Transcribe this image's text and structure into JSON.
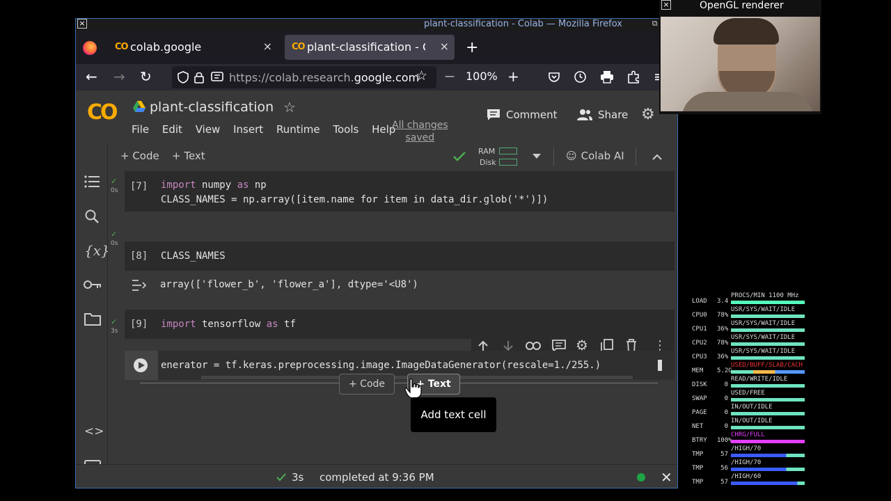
{
  "window": {
    "title": "plant-classification - Colab — Mozilla Firefox",
    "close_glyph": "×",
    "controls": "⧉ ⧈ ▣"
  },
  "browser": {
    "tabs": [
      {
        "icon": "CO",
        "label": "colab.google",
        "close": "×"
      },
      {
        "icon": "CO",
        "label": "plant-classification - Colab",
        "close": "×"
      }
    ],
    "new_tab": "+",
    "back": "←",
    "forward": "→",
    "reload": "↻",
    "url_prefix": "https://colab.research.",
    "url_domain": "google.com",
    "zoom_minus": "—",
    "zoom": "100%",
    "zoom_plus": "+"
  },
  "colab": {
    "logo": "CO",
    "notebook_title": "plant-classification",
    "menu": [
      "File",
      "Edit",
      "View",
      "Insert",
      "Runtime",
      "Tools",
      "Help"
    ],
    "save_status_line1": "All changes",
    "save_status_line2": "saved",
    "comment_label": "Comment",
    "share_label": "Share",
    "toolbar": {
      "add_code": "+ Code",
      "add_text": "+ Text",
      "ram": "RAM",
      "disk": "Disk",
      "colab_ai": "Colab AI"
    }
  },
  "cells": [
    {
      "number": "[7]",
      "duration": "0s",
      "line1_kw1": "import",
      "line1_mid": " numpy ",
      "line1_kw2": "as",
      "line1_end": " np",
      "line2": "CLASS_NAMES = np.array([item.name for item in data_dir.glob('*')])"
    },
    {
      "number": "[8]",
      "duration": "0s",
      "code": "CLASS_NAMES",
      "output": "array(['flower_b', 'flower_a'], dtype='<U8')"
    },
    {
      "number": "[9]",
      "duration": "3s",
      "line1_kw1": "import",
      "line1_mid": " tensorflow ",
      "line1_kw2": "as",
      "line1_end": " tf"
    },
    {
      "code": "enerator = tf.keras.preprocessing.image.ImageDataGenerator(rescale=1./255.)"
    }
  ],
  "insert_bar": {
    "add_code": "+ Code",
    "add_text": "+ Text",
    "tooltip": "Add text cell"
  },
  "status": {
    "duration": "3s",
    "message": "completed at 9:36 PM"
  },
  "webcam": {
    "title": "OpenGL renderer",
    "close_glyph": "×"
  },
  "monitor": {
    "rows": [
      {
        "label": "LOAD",
        "value": "3.4",
        "header": "PROCS/MIN 1100 MHz"
      },
      {
        "label": "CPU0",
        "value": "78%",
        "header": "USR/SYS/WAIT/IDLE"
      },
      {
        "label": "CPU1",
        "value": "36%",
        "header": "USR/SYS/WAIT/IDLE"
      },
      {
        "label": "CPU2",
        "value": "78%",
        "header": "USR/SYS/WAIT/IDLE"
      },
      {
        "label": "CPU3",
        "value": "36%",
        "header": "USR/SYS/WAIT/IDLE"
      },
      {
        "label": "MEM",
        "value": "5.2G",
        "header": "USED/BUFF/SLAB/CACH"
      },
      {
        "label": "DISK",
        "value": "0",
        "header": "READ/WRITE/IDLE"
      },
      {
        "label": "SWAP",
        "value": "0",
        "header": "USED/FREE"
      },
      {
        "label": "PAGE",
        "value": "0",
        "header": "IN/OUT/IDLE"
      },
      {
        "label": "NET",
        "value": "0",
        "header": "IN/OUT/IDLE"
      },
      {
        "label": "BTRY",
        "value": "100%",
        "header": "CHRG/FULL"
      },
      {
        "label": "TMP",
        "value": "57",
        "header": "/HIGH/70"
      },
      {
        "label": "TMP",
        "value": "56",
        "header": "/HIGH/70"
      },
      {
        "label": "TMP",
        "value": "57",
        "header": "/HIGH/60"
      }
    ]
  }
}
